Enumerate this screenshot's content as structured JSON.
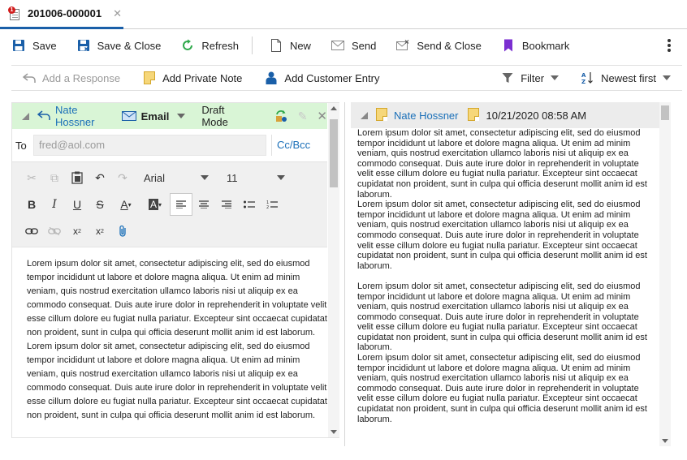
{
  "tab": {
    "title": "201006-000001",
    "badge": "1",
    "close": "✕"
  },
  "toolbar": {
    "save": "Save",
    "save_close": "Save & Close",
    "refresh": "Refresh",
    "new": "New",
    "send": "Send",
    "send_close": "Send & Close",
    "bookmark": "Bookmark"
  },
  "subbar": {
    "add_response": "Add a Response",
    "add_private_note": "Add Private Note",
    "add_customer_entry": "Add Customer Entry",
    "filter": "Filter",
    "sort": "Newest first"
  },
  "editor": {
    "author": "Nate Hossner",
    "channel": "Email",
    "mode": "Draft Mode",
    "to_label": "To",
    "to_placeholder": "fred@aol.com",
    "cc_bcc": "Cc/Bcc",
    "font": "Arial",
    "size": "11",
    "body": "Lorem ipsum dolor sit amet, consectetur adipiscing elit, sed do eiusmod\ntempor incididunt ut labore et dolore magna aliqua. Ut enim ad minim\nveniam, quis nostrud exercitation ullamco laboris nisi ut aliquip ex ea\ncommodo consequat. Duis aute irure dolor in reprehenderit in voluptate velit\nesse cillum dolore eu fugiat nulla pariatur. Excepteur sint occaecat cupidatat\nnon proident, sunt in culpa qui officia deserunt mollit anim id est laborum.\nLorem ipsum dolor sit amet, consectetur adipiscing elit, sed do eiusmod\ntempor incididunt ut labore et dolore magna aliqua. Ut enim ad minim\nveniam, quis nostrud exercitation ullamco laboris nisi ut aliquip ex ea\ncommodo consequat. Duis aute irure dolor in reprehenderit in voluptate velit\nesse cillum dolore eu fugiat nulla pariatur. Excepteur sint occaecat cupidatat\nnon proident, sunt in culpa qui officia deserunt mollit anim id est laborum."
  },
  "entry": {
    "author": "Nate Hossner",
    "date": "10/21/2020 08:58 AM",
    "body": "Lorem ipsum dolor sit amet, consectetur adipiscing elit, sed do eiusmod\ntempor incididunt ut labore et dolore magna aliqua. Ut enim ad minim\nveniam, quis nostrud exercitation ullamco laboris nisi ut aliquip ex ea\ncommodo consequat. Duis aute irure dolor in reprehenderit in voluptate\nvelit esse cillum dolore eu fugiat nulla pariatur. Excepteur sint occaecat\ncupidatat non proident, sunt in culpa qui officia deserunt mollit anim id est\nlaborum.\nLorem ipsum dolor sit amet, consectetur adipiscing elit, sed do eiusmod\ntempor incididunt ut labore et dolore magna aliqua. Ut enim ad minim\nveniam, quis nostrud exercitation ullamco laboris nisi ut aliquip ex ea\ncommodo consequat. Duis aute irure dolor in reprehenderit in voluptate\nvelit esse cillum dolore eu fugiat nulla pariatur. Excepteur sint occaecat\ncupidatat non proident, sunt in culpa qui officia deserunt mollit anim id est\nlaborum.\n\nLorem ipsum dolor sit amet, consectetur adipiscing elit, sed do eiusmod\ntempor incididunt ut labore et dolore magna aliqua. Ut enim ad minim\nveniam, quis nostrud exercitation ullamco laboris nisi ut aliquip ex ea\ncommodo consequat. Duis aute irure dolor in reprehenderit in voluptate\nvelit esse cillum dolore eu fugiat nulla pariatur. Excepteur sint occaecat\ncupidatat non proident, sunt in culpa qui officia deserunt mollit anim id est\nlaborum.\nLorem ipsum dolor sit amet, consectetur adipiscing elit, sed do eiusmod\ntempor incididunt ut labore et dolore magna aliqua. Ut enim ad minim\nveniam, quis nostrud exercitation ullamco laboris nisi ut aliquip ex ea\ncommodo consequat. Duis aute irure dolor in reprehenderit in voluptate\nvelit esse cillum dolore eu fugiat nulla pariatur. Excepteur sint occaecat\ncupidatat non proident, sunt in culpa qui officia deserunt mollit anim id est\nlaborum."
  },
  "colors": {
    "accent": "#1a5fa8",
    "link": "#1a6fb8",
    "draft_header": "#d9f5d6",
    "entry_header": "#ececec",
    "bookmark": "#7b2fd1",
    "refresh": "#2ea84a"
  }
}
